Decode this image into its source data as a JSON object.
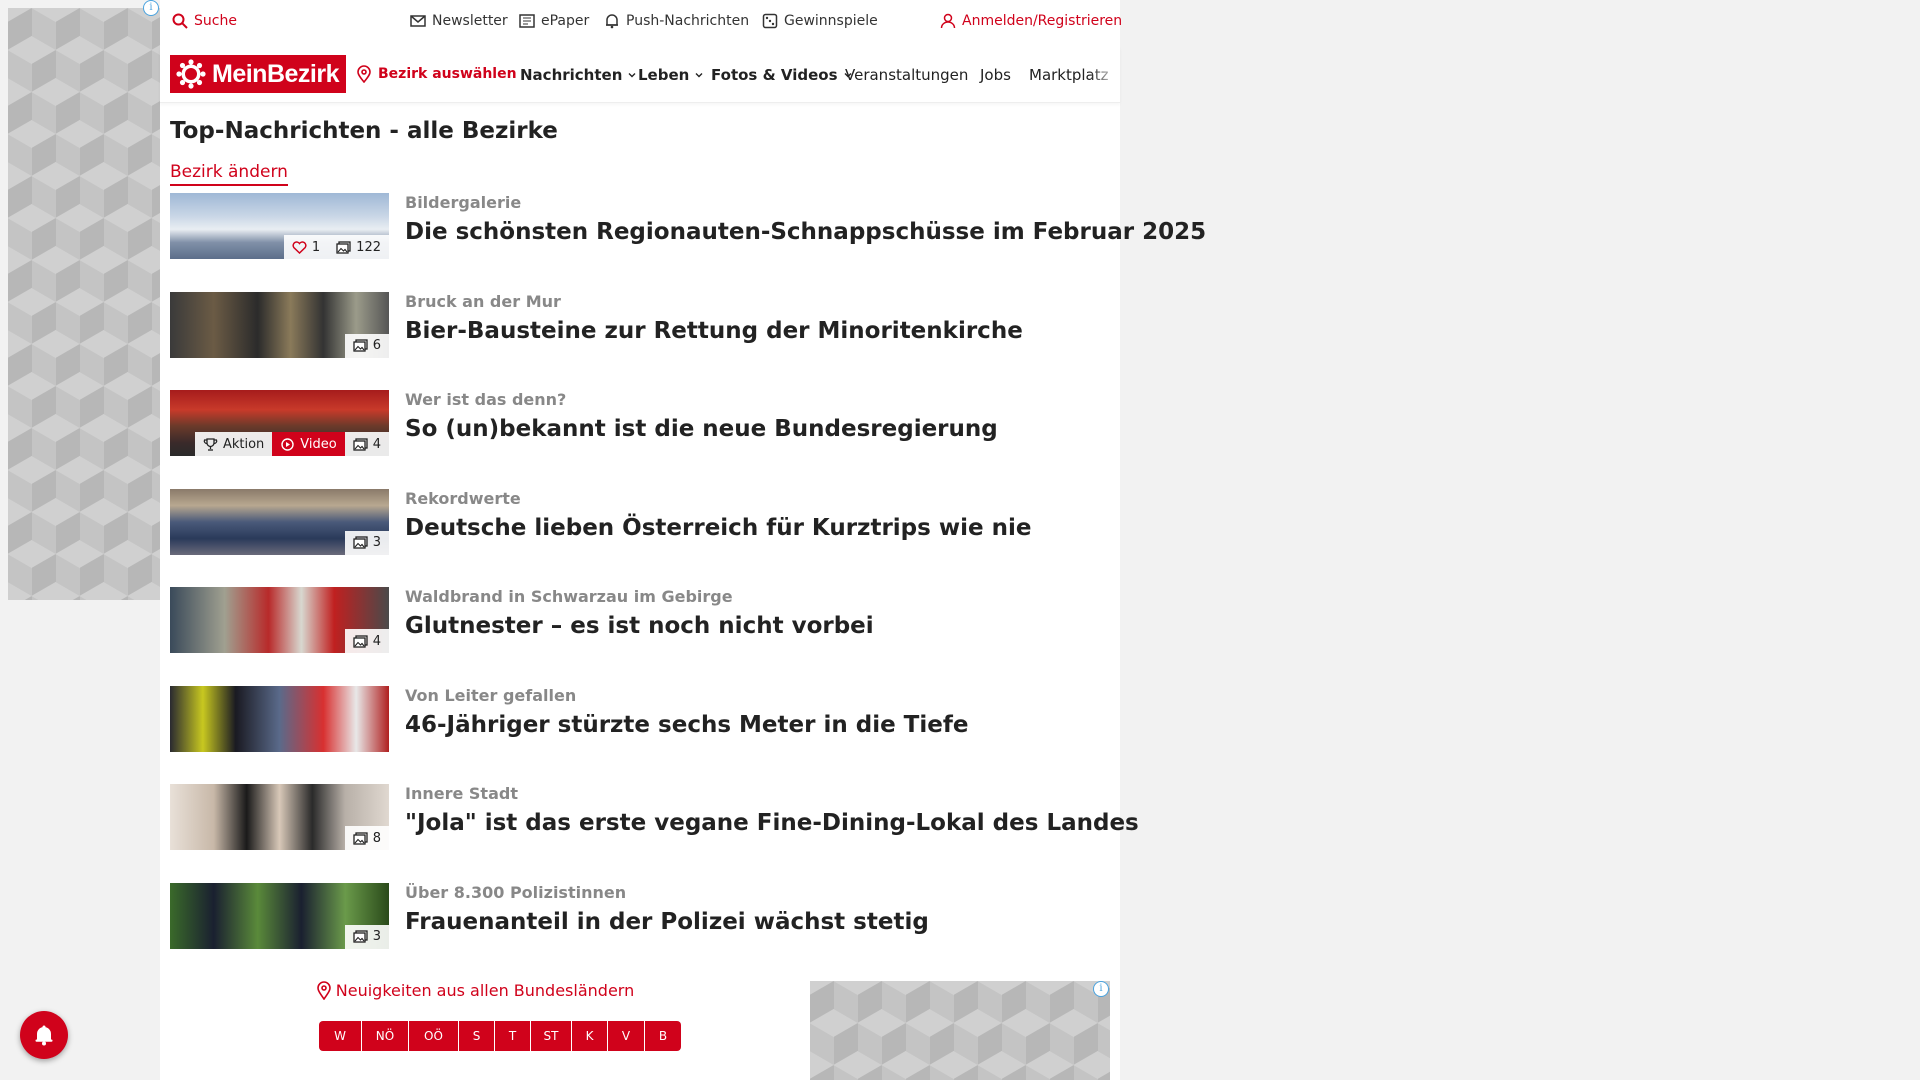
{
  "ads": {
    "info_glyph": "i"
  },
  "topbar": {
    "search_label": "Suche",
    "newsletter_label": "Newsletter",
    "epaper_label": "ePaper",
    "push_label": "Push-Nachrichten",
    "contests_label": "Gewinnspiele",
    "login_label": "Anmelden/Registrieren"
  },
  "nav": {
    "logo_text": "MeinBezirk",
    "region_label": "Bezirk auswählen",
    "items": [
      {
        "label": "Nachrichten"
      },
      {
        "label": "Leben"
      },
      {
        "label": "Fotos & Videos"
      },
      {
        "label": "Veranstaltungen"
      },
      {
        "label": "Jobs"
      },
      {
        "label": "Marktplatz"
      }
    ]
  },
  "main": {
    "title": "Top-Nachrichten - alle Bezirke",
    "change_link": "Bezirk ändern",
    "articles": [
      {
        "kicker": "Bildergalerie",
        "headline": "Die schönsten Regionauten-Schnappschüsse im Februar 2025",
        "likes": "1",
        "photos": "122"
      },
      {
        "kicker": "Bruck an der Mur",
        "headline": "Bier-Bausteine zur Rettung der Minoritenkirche",
        "photos": "6"
      },
      {
        "kicker": "Wer ist das denn?",
        "headline": "So (un)bekannt ist die neue Bundesregierung",
        "action": "Aktion",
        "video": "Video",
        "photos": "4"
      },
      {
        "kicker": "Rekordwerte",
        "headline": "Deutsche lieben Österreich für Kurztrips wie nie",
        "photos": "3"
      },
      {
        "kicker": "Waldbrand in Schwarzau im Gebirge",
        "headline": "Glutnester – es ist noch nicht vorbei",
        "photos": "4"
      },
      {
        "kicker": "Von Leiter gefallen",
        "headline": "46-Jähriger stürzte sechs Meter in die Tiefe"
      },
      {
        "kicker": "Innere Stadt",
        "headline": "\"Jola\" ist das erste vegane Fine-Dining-Lokal des Landes",
        "photos": "8"
      },
      {
        "kicker": "Über 8.300 Polizistinnen",
        "headline": "Frauenanteil in der Polizei wächst stetig",
        "photos": "3"
      }
    ]
  },
  "footer": {
    "states_label": "Neuigkeiten aus allen Bundesländern",
    "states": [
      "W",
      "NÖ",
      "OÖ",
      "S",
      "T",
      "ST",
      "K",
      "V",
      "B"
    ]
  },
  "colors": {
    "accent": "#d0021b",
    "kicker": "#888888",
    "text": "#222222"
  }
}
